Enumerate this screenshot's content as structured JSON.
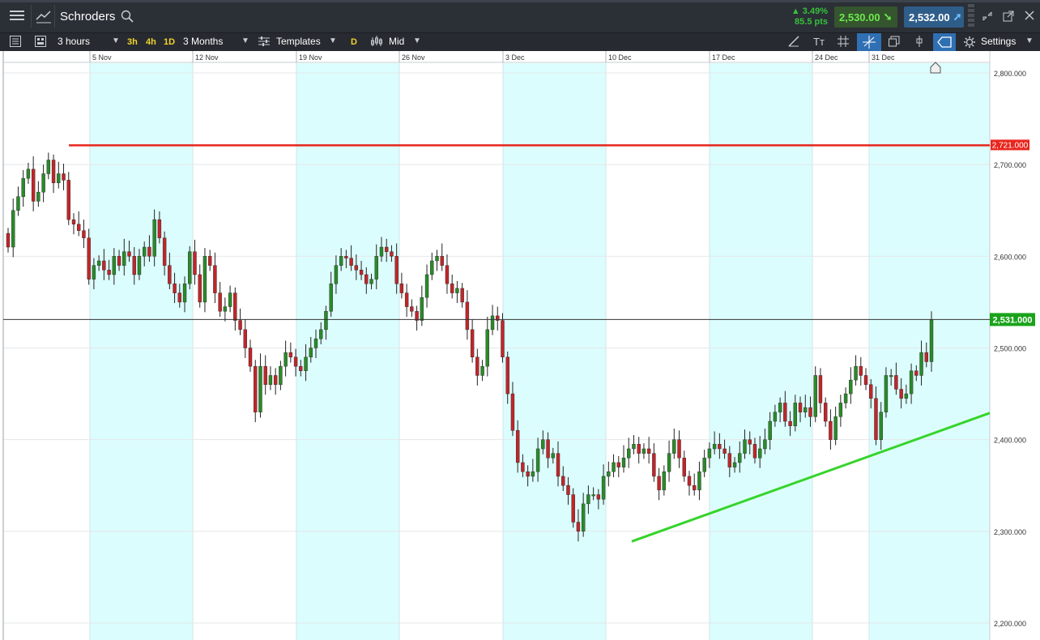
{
  "header": {
    "menu_icon": "hamburger-menu-icon",
    "chart_icon": "line-chart-icon",
    "instrument": "Schroders",
    "search_icon": "search-icon",
    "change_pct": "▲ 3.49%",
    "change_pts": "85.5 pts",
    "sell_price": "2,530.00",
    "buy_price": "2,532.00",
    "window_icons": [
      "minimize-icon",
      "popout-icon",
      "close-icon"
    ],
    "colors": {
      "change": "#35c23a",
      "sell_bg": "#35552e",
      "buy_bg": "#2f5d8a"
    }
  },
  "toolbar": {
    "interval": "3 hours",
    "quick_3h": "3h",
    "quick_4h": "4h",
    "quick_1d": "1D",
    "range": "3 Months",
    "templates": "Templates",
    "d_button": "D",
    "price_type": "Mid",
    "settings": "Settings",
    "icons": [
      "list-icon",
      "layout-icon",
      "templates-icon",
      "candles-icon",
      "draw-line-icon",
      "text-tool-icon",
      "grid-icon",
      "crosshair-icon",
      "multi-window-icon",
      "marker-icon",
      "label-tool-icon",
      "gear-icon"
    ]
  },
  "chart_data": {
    "type": "candlestick",
    "y_axis": {
      "ticks": [
        "2,800.000",
        "2,700.000",
        "2,600.000",
        "2,500.000",
        "2,400.000",
        "2,300.000",
        "2,200.000"
      ],
      "tick_values": [
        2800,
        2700,
        2600,
        2500,
        2400,
        2300,
        2200
      ],
      "range": [
        2190,
        2812
      ]
    },
    "x_axis": {
      "labels": [
        "5 Nov",
        "12 Nov",
        "19 Nov",
        "26 Nov",
        "3 Dec",
        "10 Dec",
        "17 Dec",
        "24 Dec",
        "31 Dec"
      ],
      "shaded_weeks": true
    },
    "resistance_line": {
      "label": "2,721.000",
      "value": 2721,
      "color": "#e8261e"
    },
    "current_price": {
      "label": "2,531.000",
      "value": 2531,
      "color": "#1aa31a"
    },
    "support_line": {
      "from_value": 2289,
      "to_value": 2429,
      "color": "#35d42a"
    },
    "colors": {
      "up": "#2a8a2a",
      "down": "#c0262a",
      "shade": "#dcfdfd"
    },
    "closes": [
      2610,
      2650,
      2665,
      2685,
      2695,
      2660,
      2670,
      2690,
      2705,
      2680,
      2690,
      2683,
      2640,
      2635,
      2628,
      2620,
      2575,
      2590,
      2595,
      2585,
      2580,
      2600,
      2590,
      2605,
      2600,
      2580,
      2600,
      2610,
      2600,
      2640,
      2620,
      2590,
      2570,
      2560,
      2550,
      2570,
      2605,
      2580,
      2550,
      2600,
      2590,
      2560,
      2540,
      2545,
      2560,
      2530,
      2520,
      2500,
      2480,
      2430,
      2480,
      2460,
      2470,
      2460,
      2480,
      2495,
      2490,
      2480,
      2475,
      2490,
      2500,
      2510,
      2520,
      2540,
      2570,
      2590,
      2600,
      2598,
      2590,
      2585,
      2580,
      2570,
      2575,
      2600,
      2610,
      2605,
      2600,
      2570,
      2560,
      2545,
      2540,
      2530,
      2555,
      2580,
      2595,
      2600,
      2590,
      2570,
      2560,
      2565,
      2550,
      2520,
      2490,
      2470,
      2480,
      2520,
      2535,
      2530,
      2490,
      2450,
      2410,
      2375,
      2365,
      2360,
      2365,
      2390,
      2400,
      2380,
      2385,
      2360,
      2350,
      2340,
      2310,
      2300,
      2330,
      2340,
      2340,
      2335,
      2360,
      2365,
      2375,
      2370,
      2380,
      2390,
      2395,
      2385,
      2390,
      2385,
      2360,
      2345,
      2365,
      2385,
      2400,
      2380,
      2360,
      2350,
      2345,
      2365,
      2380,
      2390,
      2395,
      2390,
      2385,
      2370,
      2375,
      2385,
      2400,
      2395,
      2380,
      2390,
      2400,
      2420,
      2430,
      2440,
      2420,
      2415,
      2440,
      2430,
      2435,
      2425,
      2470,
      2440,
      2420,
      2400,
      2425,
      2440,
      2450,
      2465,
      2480,
      2470,
      2460,
      2445,
      2400,
      2430,
      2470,
      2470,
      2455,
      2445,
      2450,
      2475,
      2470,
      2495,
      2485,
      2531
    ]
  }
}
